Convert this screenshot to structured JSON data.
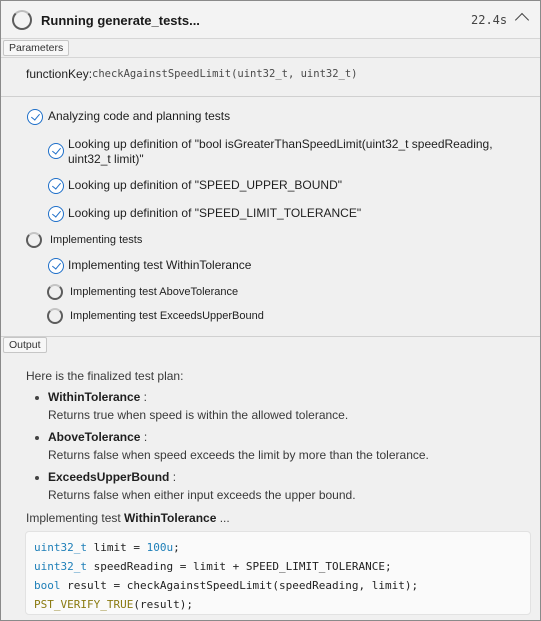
{
  "header": {
    "title": "Running generate_tests...",
    "elapsed": "22.4s"
  },
  "parameters": {
    "section_label": "Parameters",
    "function_key_label": "functionKey:",
    "function_key_value": "checkAgainstSpeedLimit(uint32_t, uint32_t)"
  },
  "steps": [
    {
      "status": "done",
      "text": "Analyzing code and planning tests"
    },
    {
      "status": "done",
      "text_line1": "Looking up definition of \"bool isGreaterThanSpeedLimit(uint32_t speedReading,",
      "text_line2": "uint32_t limit)\""
    },
    {
      "status": "done",
      "text": "Looking up definition of \"SPEED_UPPER_BOUND\""
    },
    {
      "status": "done",
      "text": "Looking up definition of \"SPEED_LIMIT_TOLERANCE\""
    },
    {
      "status": "running",
      "text": "Implementing tests"
    },
    {
      "status": "done",
      "text": "Implementing test WithinTolerance"
    },
    {
      "status": "running",
      "text": "Implementing test AboveTolerance"
    },
    {
      "status": "running",
      "text": "Implementing test ExceedsUpperBound"
    }
  ],
  "output": {
    "section_label": "Output",
    "intro": "Here is the finalized test plan:",
    "tests": [
      {
        "name": "WithinTolerance",
        "sep": " :",
        "description": "Returns true when speed is within the allowed tolerance."
      },
      {
        "name": "AboveTolerance",
        "sep": " :",
        "description": "Returns false when speed exceeds the limit by more than the tolerance."
      },
      {
        "name": "ExceedsUpperBound",
        "sep": " :",
        "description": "Returns false when either input exceeds the upper bound."
      }
    ],
    "implementing_prefix": "Implementing test ",
    "implementing_name": "WithinTolerance",
    "implementing_suffix": " ...",
    "code": {
      "line1_type": "uint32_t",
      "line1_rest": " limit = ",
      "line1_num": "100u",
      "line1_end": ";",
      "line2_type": "uint32_t",
      "line2_rest": " speedReading = limit + SPEED_LIMIT_TOLERANCE;",
      "line3_type": "bool",
      "line3_rest": " result = checkAgainstSpeedLimit(speedReading, limit);",
      "line4_macro": "PST_VERIFY_TRUE",
      "line4_rest": "(result);"
    }
  },
  "colors": {
    "accent": "#1e6fc9",
    "keyword": "#1e7fb8",
    "macro": "#8a7a10"
  }
}
